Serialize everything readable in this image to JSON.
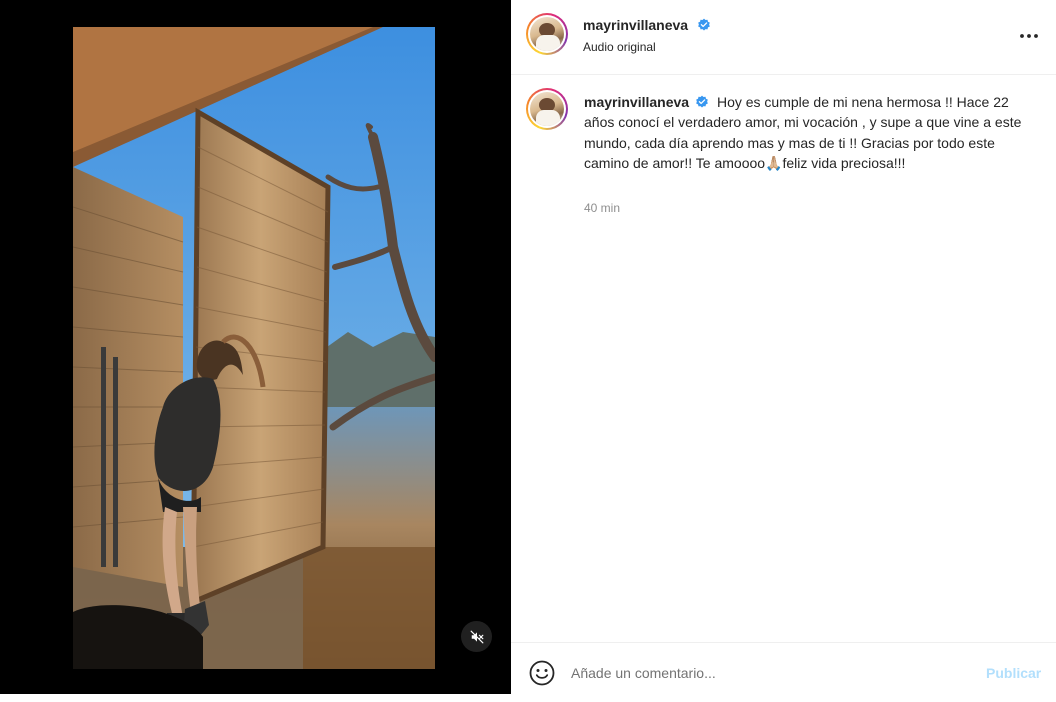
{
  "post": {
    "username": "mayrinvillaneva",
    "audio_label": "Audio original",
    "caption_body": "Hoy es cumple de mi nena hermosa !! Hace 22 años conocí el verdadero amor, mi vocación , y supe a que vine a este mundo, cada día aprendo mas y mas de ti !! Gracias por todo este camino de amor!! Te amoooo🙏🏼feliz vida preciosa!!!",
    "timestamp": "40 min"
  },
  "comment": {
    "placeholder": "Añade un comentario...",
    "publish_label": "Publicar"
  },
  "icons": {
    "verified": "verified-badge-icon",
    "more": "more-options-icon",
    "emoji": "emoji-icon",
    "mute": "muted-speaker-icon"
  },
  "colors": {
    "verified": "#3897f0",
    "publish_disabled": "#b2dffc",
    "timestamp": "#8e8e8e"
  }
}
